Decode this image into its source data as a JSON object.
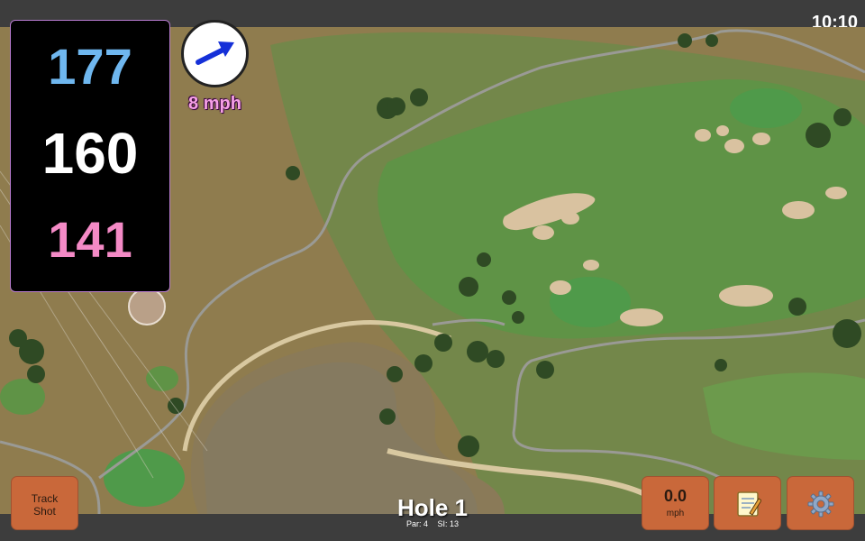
{
  "status": {
    "time": "10:10"
  },
  "distances": {
    "back": "177",
    "middle": "160",
    "front": "141"
  },
  "wind": {
    "speed_label": "8 mph",
    "arrow_color": "#1530d8"
  },
  "hole": {
    "title": "Hole 1",
    "par_label": "Par: 4",
    "si_label": "SI: 13"
  },
  "buttons": {
    "track_line1": "Track",
    "track_line2": "Shot",
    "speed_value": "0.0",
    "speed_unit": "mph",
    "notes_icon": "notepad-icon",
    "settings_icon": "gear-icon"
  },
  "colors": {
    "back": "#6fb7ef",
    "middle": "#ffffff",
    "front": "#f48ac6",
    "button": "#c9683a",
    "bar": "#3d3d3d"
  }
}
